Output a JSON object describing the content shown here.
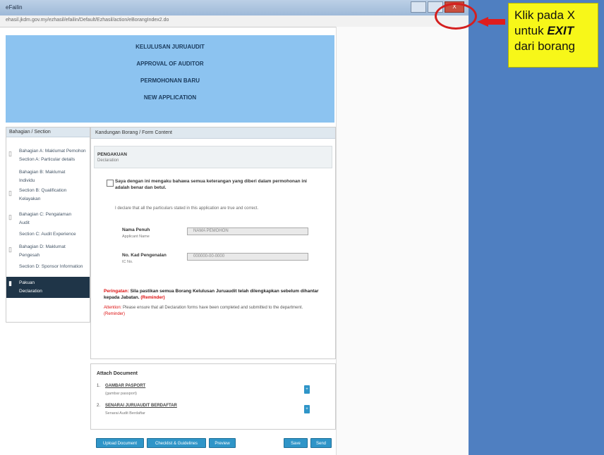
{
  "browser": {
    "title": "eFailin",
    "url": "ehasil.jkdm.gov.my/ezhasil/efailin/Default/Ezhasil/action/eBorangIndex2.do",
    "close_label": "X",
    "restore_label": "",
    "minimize_label": ""
  },
  "annotation": {
    "line1": "Klik pada X",
    "line2_prefix": "untuk ",
    "line2_em": "EXIT",
    "line3": "dari borang",
    "circle_color": "#d41f1f",
    "arrow_color": "#e01d1d",
    "callout_color": "#f7f719"
  },
  "header": {
    "lines": [
      "KELULUSAN JURUAUDIT",
      "APPROVAL OF AUDITOR",
      "PERMOHONAN BARU",
      "NEW APPLICATION"
    ],
    "bg_color": "#8cc3f0"
  },
  "nav": {
    "heading": "Bahagian / Section",
    "items": [
      {
        "label": "Bahagian A: Maklumat Pemohon",
        "sub": "Section A: Particular details"
      },
      {
        "label": "Bahagian B: Maklumat",
        "sub": "Individu"
      },
      {
        "label": "Section B: Qualification",
        "sub": "Kelayakan"
      },
      {
        "label": "Bahagian C: Pengalaman",
        "sub": "Audit"
      },
      {
        "label": "Section C: Audit Experience",
        "sub": ""
      },
      {
        "label": "Bahagian D: Maklumat",
        "sub": "Pengesah"
      },
      {
        "label": "Section D: Sponsor Information",
        "sub": ""
      },
      {
        "label": "Pakuan",
        "sub": "Declaration"
      }
    ]
  },
  "form": {
    "header": "Kandungan Borang / Form Content",
    "section_title": "PENGAKUAN",
    "section_sub": "Declaration",
    "declaration": "Saya dengan ini mengaku bahawa semua keterangan yang diberi dalam permohonan ini adalah benar dan betul.",
    "declaration_en": "I declare that all the particulars stated in this application are true and correct.",
    "name_label": "Nama Penuh",
    "name_sub": "Applicant Name",
    "name_value": "NAMA PEMOHON",
    "ic_label": "No. Kad Pengenalan",
    "ic_sub": "IC No.",
    "ic_value": "000000-00-0000",
    "warning_prefix": "Peringatan:",
    "warning_text": " Sila pastikan semua Borang Kelulusan Juruaudit telah dilengkapkan sebelum dihantar kepada Jabatan.",
    "warning_suffix": "(Reminder)",
    "warning2_prefix": "Attention:",
    "warning2_text": " Please ensure that all Declaration forms have been completed and submitted to the department.",
    "warning2_suffix": "(Reminder)"
  },
  "docs": {
    "heading": "Attach Document",
    "items": [
      {
        "num": "1.",
        "name": "GAMBAR PASPORT",
        "sub": "(gambar passport)",
        "btn": "+"
      },
      {
        "num": "2.",
        "name": "SENARAI JURUAUDIT BERDAFTAR",
        "sub": "Senarai Audit Berdaftar",
        "btn": "+"
      }
    ]
  },
  "actions": {
    "upload": "Upload Document",
    "checklist": "Checklist & Guidelines",
    "preview": "Preview",
    "save": "Save",
    "submit": "Send"
  }
}
